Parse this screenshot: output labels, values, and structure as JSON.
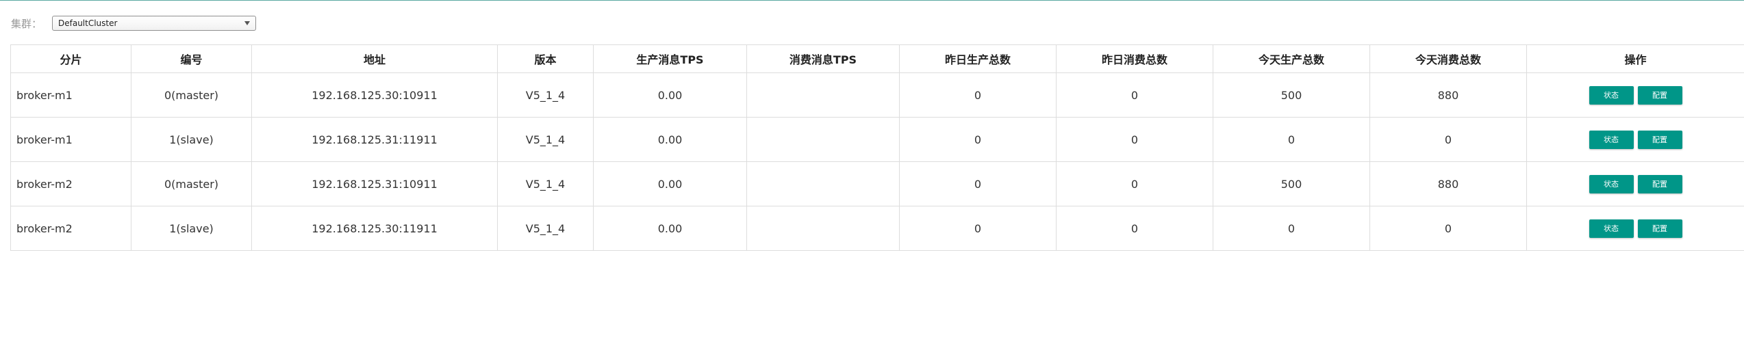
{
  "cluster": {
    "label": "集群：",
    "selected": "DefaultCluster"
  },
  "table": {
    "headers": [
      "分片",
      "编号",
      "地址",
      "版本",
      "生产消息TPS",
      "消费消息TPS",
      "昨日生产总数",
      "昨日消费总数",
      "今天生产总数",
      "今天消费总数",
      "操作"
    ],
    "rows": [
      {
        "shard": "broker-m1",
        "id": "0(master)",
        "address": "192.168.125.30:10911",
        "version": "V5_1_4",
        "produce_tps": "0.00",
        "consume_tps": "",
        "yesterday_produce": "0",
        "yesterday_consume": "0",
        "today_produce": "500",
        "today_consume": "880"
      },
      {
        "shard": "broker-m1",
        "id": "1(slave)",
        "address": "192.168.125.31:11911",
        "version": "V5_1_4",
        "produce_tps": "0.00",
        "consume_tps": "",
        "yesterday_produce": "0",
        "yesterday_consume": "0",
        "today_produce": "0",
        "today_consume": "0"
      },
      {
        "shard": "broker-m2",
        "id": "0(master)",
        "address": "192.168.125.31:10911",
        "version": "V5_1_4",
        "produce_tps": "0.00",
        "consume_tps": "",
        "yesterday_produce": "0",
        "yesterday_consume": "0",
        "today_produce": "500",
        "today_consume": "880"
      },
      {
        "shard": "broker-m2",
        "id": "1(slave)",
        "address": "192.168.125.30:11911",
        "version": "V5_1_4",
        "produce_tps": "0.00",
        "consume_tps": "",
        "yesterday_produce": "0",
        "yesterday_consume": "0",
        "today_produce": "0",
        "today_consume": "0"
      }
    ],
    "actions": {
      "status_label": "状态",
      "config_label": "配置"
    }
  },
  "colors": {
    "accent": "#009688",
    "border": "#dddddd",
    "top_rule": "#5aa9a2"
  }
}
